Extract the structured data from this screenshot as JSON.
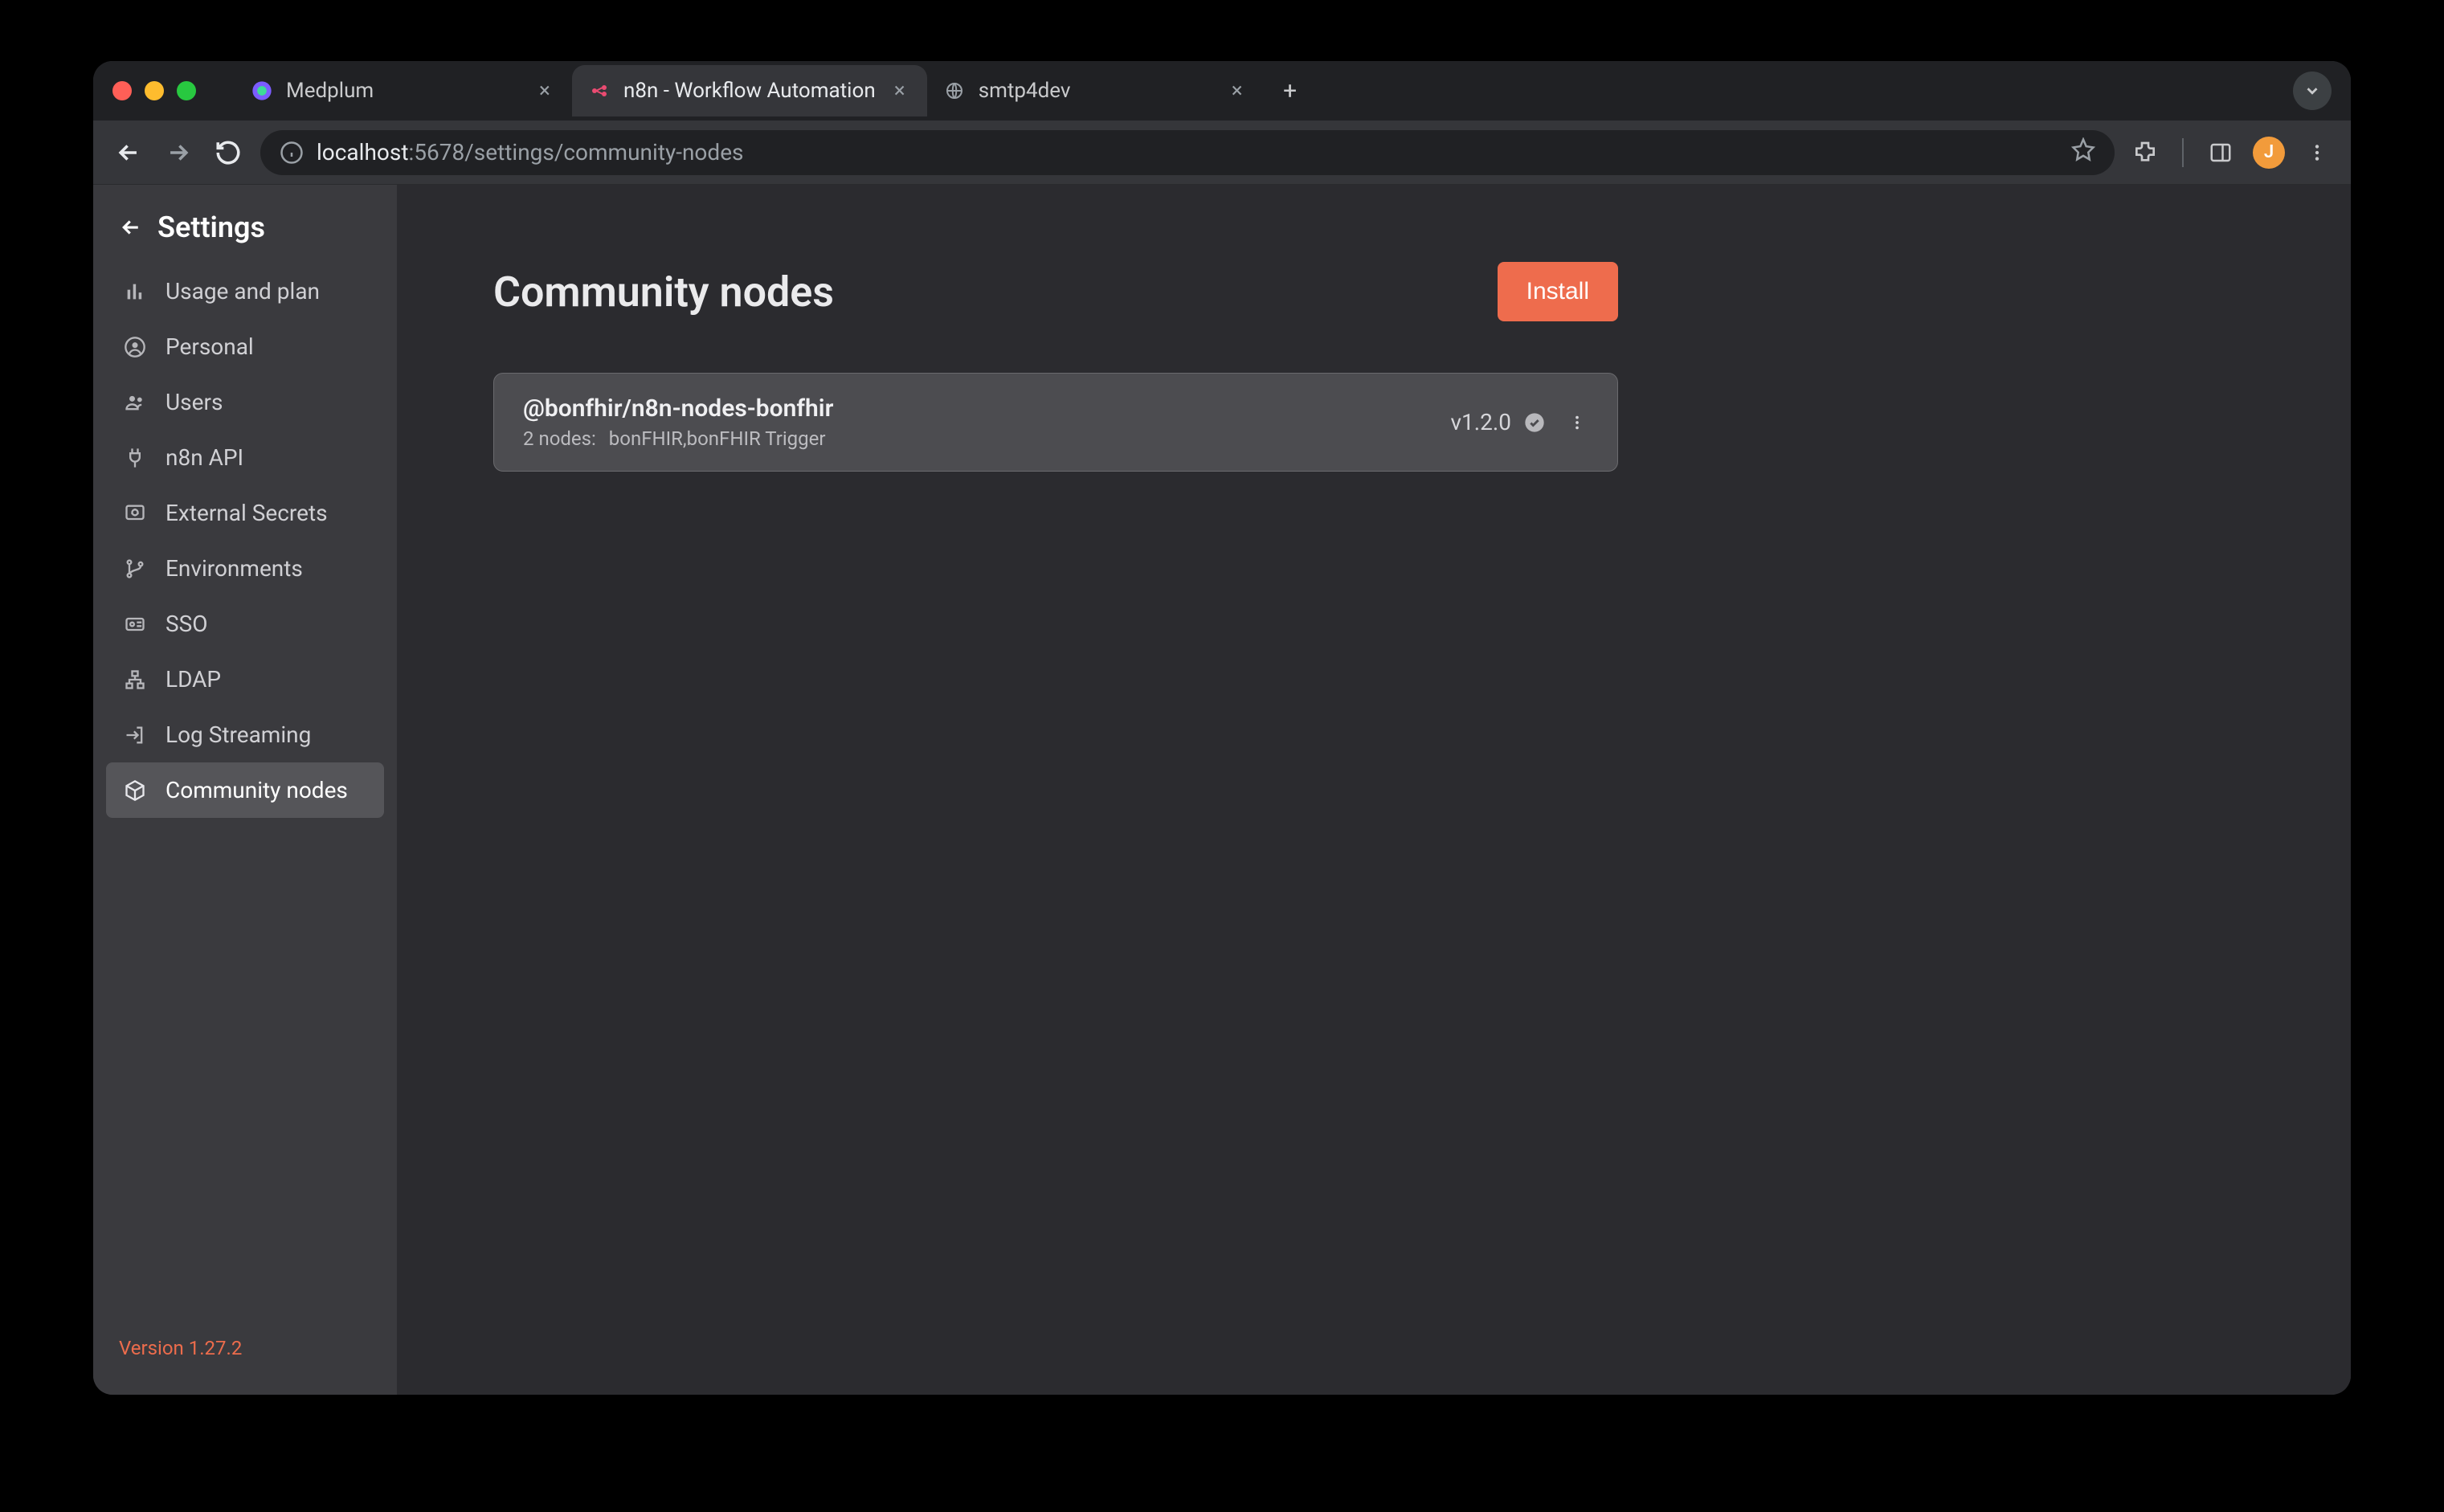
{
  "browser": {
    "tabs": [
      {
        "title": "Medplum",
        "active": false
      },
      {
        "title": "n8n - Workflow Automation",
        "active": true
      },
      {
        "title": "smtp4dev",
        "active": false
      }
    ],
    "url_host": "localhost",
    "url_port_path": ":5678/settings/community-nodes",
    "avatar_letter": "J"
  },
  "sidebar": {
    "title": "Settings",
    "items": [
      {
        "label": "Usage and plan",
        "icon": "chart-bar-icon"
      },
      {
        "label": "Personal",
        "icon": "user-circle-icon"
      },
      {
        "label": "Users",
        "icon": "users-icon"
      },
      {
        "label": "n8n API",
        "icon": "plug-icon"
      },
      {
        "label": "External Secrets",
        "icon": "vault-icon"
      },
      {
        "label": "Environments",
        "icon": "git-branch-icon"
      },
      {
        "label": "SSO",
        "icon": "id-card-icon"
      },
      {
        "label": "LDAP",
        "icon": "sitemap-icon"
      },
      {
        "label": "Log Streaming",
        "icon": "sign-out-icon"
      },
      {
        "label": "Community nodes",
        "icon": "cube-icon"
      }
    ],
    "active_index": 9,
    "version": "Version 1.27.2"
  },
  "main": {
    "title": "Community nodes",
    "install_label": "Install",
    "packages": [
      {
        "name": "@bonfhir/n8n-nodes-bonfhir",
        "count_label": "2 nodes:",
        "nodes": "bonFHIR,bonFHIR Trigger",
        "version": "v1.2.0"
      }
    ]
  }
}
